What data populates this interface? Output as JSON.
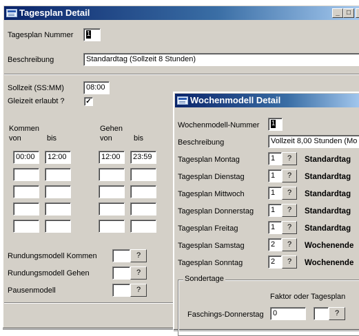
{
  "tagesplan": {
    "title": "Tagesplan Detail",
    "controls": {
      "minimize": "_",
      "maximize": "□",
      "close": "X"
    },
    "nummer_label": "Tagesplan Nummer",
    "nummer_value": "1",
    "beschreibung_label": "Beschreibung",
    "beschreibung_value": "Standardtag (Sollzeit 8 Stunden)",
    "sollzeit_label": "Sollzeit (SS:MM)",
    "sollzeit_value": "08:00",
    "gleitzeit_label": "Gleizeit erlaubt ?",
    "gleitzeit_checked": "✓",
    "kommen_label": "Kommen",
    "gehen_label": "Gehen",
    "von_label": "von",
    "bis_label": "bis",
    "rows": [
      {
        "k_von": "00:00",
        "k_bis": "12:00",
        "g_von": "12:00",
        "g_bis": "23:59"
      },
      {
        "k_von": "",
        "k_bis": "",
        "g_von": "",
        "g_bis": ""
      },
      {
        "k_von": "",
        "k_bis": "",
        "g_von": "",
        "g_bis": ""
      },
      {
        "k_von": "",
        "k_bis": "",
        "g_von": "",
        "g_bis": ""
      },
      {
        "k_von": "",
        "k_bis": "",
        "g_von": "",
        "g_bis": ""
      }
    ],
    "rundung_kommen_label": "Rundungsmodell Kommen",
    "rundung_gehen_label": "Rundungsmodell Gehen",
    "pausen_label": "Pausenmodell",
    "lookup_label": "?"
  },
  "wochenmodell": {
    "title": "Wochenmodell Detail",
    "nummer_label": "Wochenmodell-Nummer",
    "nummer_value": "1",
    "beschreibung_label": "Beschreibung",
    "beschreibung_value": "Vollzeit 8,00 Stunden (Mo",
    "days": [
      {
        "label": "Tagesplan Montag",
        "value": "1",
        "name": "Standardtag"
      },
      {
        "label": "Tagesplan Dienstag",
        "value": "1",
        "name": "Standardtag"
      },
      {
        "label": "Tagesplan Mittwoch",
        "value": "1",
        "name": "Standardtag"
      },
      {
        "label": "Tagesplan Donnerstag",
        "value": "1",
        "name": "Standardtag"
      },
      {
        "label": "Tagesplan Freitag",
        "value": "1",
        "name": "Standardtag"
      },
      {
        "label": "Tagesplan Samstag",
        "value": "2",
        "name": "Wochenende"
      },
      {
        "label": "Tagesplan Sonntag",
        "value": "2",
        "name": "Wochenende"
      }
    ],
    "lookup_label": "?",
    "sondertage_label": "Sondertage",
    "faktor_label": "Faktor oder Tagesplan",
    "fasching_label": "Faschings-Donnerstag",
    "fasching_value": "0"
  }
}
